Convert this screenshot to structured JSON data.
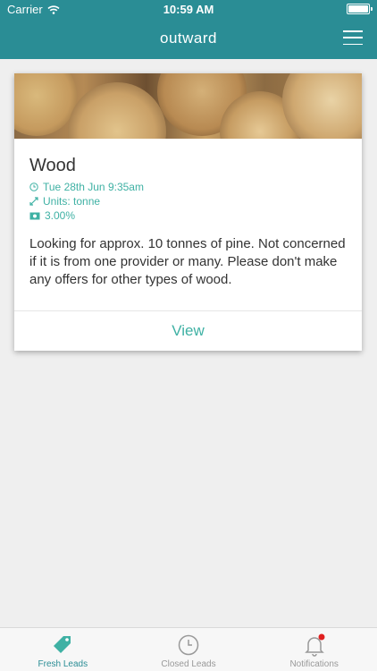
{
  "status_bar": {
    "carrier": "Carrier",
    "time": "10:59 AM"
  },
  "nav": {
    "title": "outward",
    "menu_icon": "hamburger-menu-icon"
  },
  "card": {
    "title": "Wood",
    "date": "Tue 28th Jun 9:35am",
    "units": "Units: tonne",
    "percent": "3.00%",
    "description": "Looking for approx. 10 tonnes of pine. Not concerned if it is from one provider or many. Please don't make any offers for other types of wood.",
    "view_label": "View"
  },
  "tabs": [
    {
      "label": "Fresh Leads",
      "icon": "tag-icon",
      "active": true
    },
    {
      "label": "Closed Leads",
      "icon": "clock-icon",
      "active": false
    },
    {
      "label": "Notifications",
      "icon": "bell-icon",
      "active": false,
      "badge": true
    }
  ],
  "colors": {
    "brand": "#2a8d95",
    "accent": "#3fb1a4",
    "badge": "#e02020"
  }
}
